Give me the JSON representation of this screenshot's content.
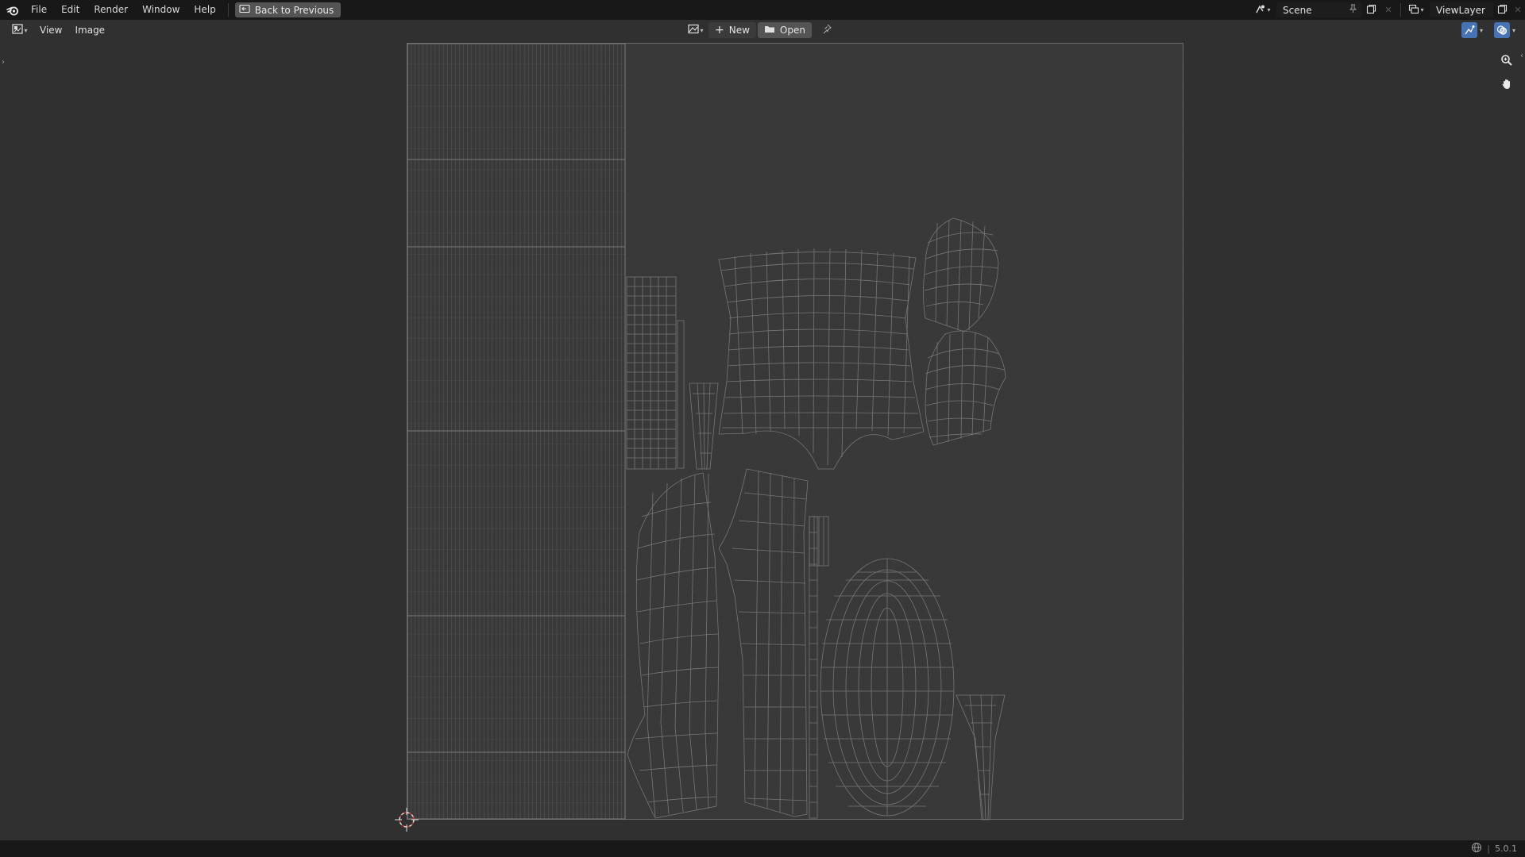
{
  "topbar": {
    "menus": [
      "File",
      "Edit",
      "Render",
      "Window",
      "Help"
    ],
    "back_button": "Back to Previous",
    "scene": "Scene",
    "view_layer": "ViewLayer"
  },
  "editor_header": {
    "menus": [
      "View",
      "Image"
    ],
    "new_label": "New",
    "open_label": "Open"
  },
  "statusbar": {
    "version": "5.0.1"
  },
  "icons": {
    "logo": "blender-logo-icon",
    "back": "back-to-previous-icon",
    "scene": "scene-icon",
    "pin": "pin-icon",
    "new_scene": "duplicate-icon",
    "close": "close-icon",
    "view_layer": "view-layer-icon",
    "editor_type": "image-editor-icon",
    "image_browse": "image-browse-icon",
    "add": "plus-icon",
    "folder": "folder-icon",
    "uv_sync": "uv-sync-icon",
    "overlay": "overlay-icon",
    "zoom": "zoom-icon",
    "pan": "hand-pan-icon",
    "cursor": "2d-cursor-icon",
    "network": "network-icon"
  },
  "colors": {
    "ui_bg": "#303030",
    "topbar_bg": "#181818",
    "accent": "#4772b3",
    "uv_wire": "#7c7c7c"
  }
}
